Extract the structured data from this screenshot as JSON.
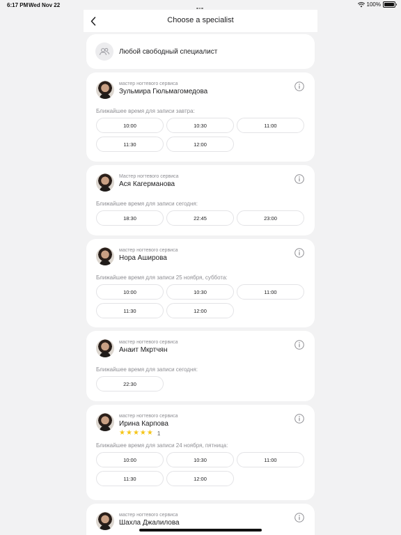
{
  "status_bar": {
    "time": "6:17 PM",
    "date": "Wed Nov 22",
    "battery": "100%"
  },
  "header": {
    "title": "Choose a specialist"
  },
  "any_specialist": {
    "label": "Любой свободный специалист"
  },
  "specialists": [
    {
      "role": "мастер ногтевого сервиса",
      "name": "Зульмира Гюльмагомедова",
      "next_label": "Ближайшее время для записи завтра:",
      "slots": [
        "10:00",
        "10:30",
        "11:00",
        "11:30",
        "12:00"
      ]
    },
    {
      "role": "Мастер ногтевого сервиса",
      "name": "Ася Кагерманова",
      "next_label": "Ближайшее время для записи сегодня:",
      "slots": [
        "18:30",
        "22:45",
        "23:00"
      ]
    },
    {
      "role": "мастер ногтевого сервиса",
      "name": "Нора Аширова",
      "next_label": "Ближайшее время для записи 25 ноября, суббота:",
      "slots": [
        "10:00",
        "10:30",
        "11:00",
        "11:30",
        "12:00"
      ]
    },
    {
      "role": "мастер ногтевого сервиса",
      "name": "Анаит Мкртчян",
      "next_label": "Ближайшее время для записи сегодня:",
      "slots": [
        "22:30"
      ]
    },
    {
      "role": "мастер ногтевого сервиса",
      "name": "Ирина Карпова",
      "rating": {
        "stars": 5,
        "count": "1"
      },
      "next_label": "Ближайшее время для записи 24 ноября, пятница:",
      "slots": [
        "10:00",
        "10:30",
        "11:00",
        "11:30",
        "12:00"
      ]
    },
    {
      "role": "мастер ногтевого сервиса",
      "name": "Шахла Джалилова"
    }
  ],
  "colors": {
    "background": "#f2f2f3",
    "card": "#ffffff",
    "secondary_text": "#8e8e93",
    "star": "#f5c518"
  }
}
